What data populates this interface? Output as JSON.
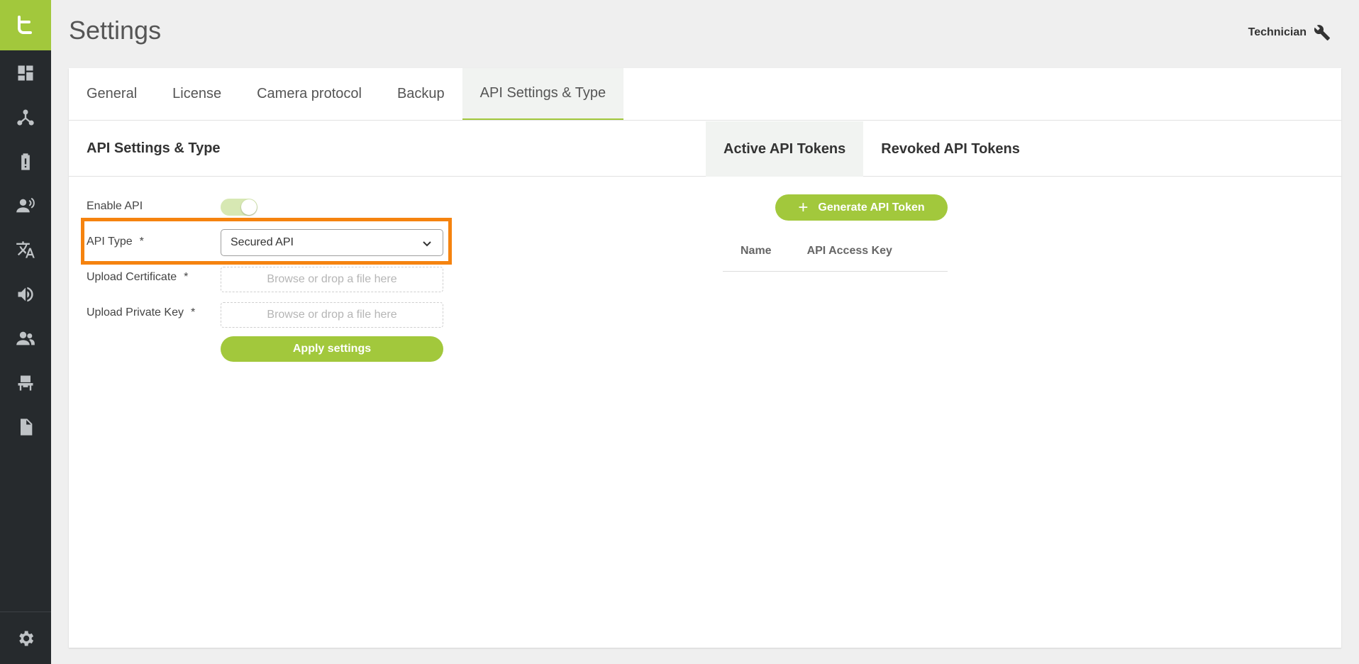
{
  "app": {
    "logo_letter": "t",
    "brand_color": "#a2c83c"
  },
  "header": {
    "title": "Settings",
    "user_label": "Technician",
    "user_icon": "wrench-icon"
  },
  "sidebar": {
    "items": [
      {
        "icon": "dashboard-icon"
      },
      {
        "icon": "network-icon"
      },
      {
        "icon": "battery-icon"
      },
      {
        "icon": "speaker-person-icon"
      },
      {
        "icon": "translate-icon"
      },
      {
        "icon": "volume-icon"
      },
      {
        "icon": "users-icon"
      },
      {
        "icon": "seat-icon"
      },
      {
        "icon": "document-icon"
      }
    ],
    "bottom_icon": "gear-icon"
  },
  "tabs": [
    "General",
    "License",
    "Camera protocol",
    "Backup",
    "API Settings & Type"
  ],
  "active_tab": "API Settings & Type",
  "section": {
    "title": "API Settings & Type",
    "token_tabs": [
      "Active API Tokens",
      "Revoked API Tokens"
    ]
  },
  "form": {
    "enable_api_label": "Enable API",
    "enable_api_value": true,
    "api_type_label": "API Type",
    "api_type_value": "Secured API",
    "required_mark": "*",
    "upload_certificate_label": "Upload Certificate",
    "upload_certificate_placeholder": "Browse or drop a file here",
    "upload_private_key_label": "Upload Private Key",
    "upload_private_key_placeholder": "Browse or drop a file here",
    "apply_label": "Apply settings"
  },
  "tokens": {
    "generate_label": "Generate API Token",
    "plus": "+",
    "columns": [
      "Name",
      "API Access Key"
    ]
  },
  "colors": {
    "accent": "#a2c83c",
    "highlight": "#f5830f",
    "sidebar": "#262a2d"
  }
}
